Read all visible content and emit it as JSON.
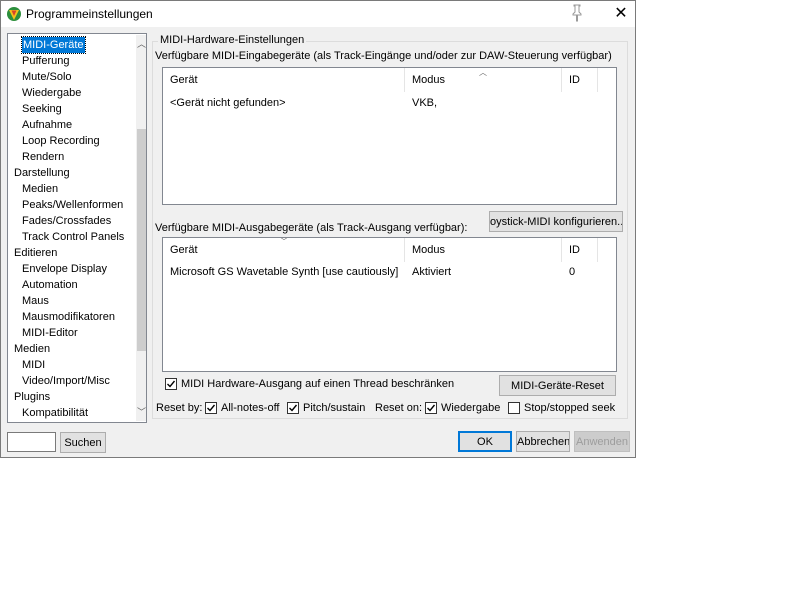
{
  "window": {
    "title": "Programmeinstellungen"
  },
  "tree": {
    "items": [
      {
        "label": "MIDI-Geräte",
        "level": 1,
        "selected": true
      },
      {
        "label": "Pufferung",
        "level": 1
      },
      {
        "label": "Mute/Solo",
        "level": 1
      },
      {
        "label": "Wiedergabe",
        "level": 1
      },
      {
        "label": "Seeking",
        "level": 1
      },
      {
        "label": "Aufnahme",
        "level": 1
      },
      {
        "label": "Loop Recording",
        "level": 1
      },
      {
        "label": "Rendern",
        "level": 1
      },
      {
        "label": "Darstellung",
        "level": 0
      },
      {
        "label": "Medien",
        "level": 1
      },
      {
        "label": "Peaks/Wellenformen",
        "level": 1
      },
      {
        "label": "Fades/Crossfades",
        "level": 1
      },
      {
        "label": "Track Control Panels",
        "level": 1
      },
      {
        "label": "Editieren",
        "level": 0
      },
      {
        "label": "Envelope Display",
        "level": 1
      },
      {
        "label": "Automation",
        "level": 1
      },
      {
        "label": "Maus",
        "level": 1
      },
      {
        "label": "Mausmodifikatoren",
        "level": 1
      },
      {
        "label": "MIDI-Editor",
        "level": 1
      },
      {
        "label": "Medien",
        "level": 0
      },
      {
        "label": "MIDI",
        "level": 1
      },
      {
        "label": "Video/Import/Misc",
        "level": 1
      },
      {
        "label": "Plugins",
        "level": 0
      },
      {
        "label": "Kompatibilität",
        "level": 1
      }
    ]
  },
  "group": {
    "title": "MIDI-Hardware-Einstellungen"
  },
  "inputs": {
    "label": "Verfügbare MIDI-Eingabegeräte (als Track-Eingänge und/oder zur DAW-Steuerung verfügbar)",
    "columns": [
      "Gerät",
      "Modus",
      "ID"
    ],
    "rows": [
      [
        "<Gerät nicht gefunden>",
        "VKB,",
        ""
      ]
    ]
  },
  "outputs": {
    "label": "Verfügbare MIDI-Ausgabegeräte (als Track-Ausgang verfügbar):",
    "joystick_button": "oystick-MIDI konfigurieren...",
    "columns": [
      "Gerät",
      "Modus",
      "ID"
    ],
    "rows": [
      [
        "Microsoft GS Wavetable Synth [use cautiously]",
        "Aktiviert",
        "0"
      ]
    ]
  },
  "options": {
    "thread_limit": {
      "label": "MIDI Hardware-Ausgang auf einen Thread beschränken",
      "checked": true
    },
    "reset_button": "MIDI-Geräte-Reset",
    "reset_by_label": "Reset by:",
    "all_notes_off": {
      "label": "All-notes-off",
      "checked": true
    },
    "pitch_sustain": {
      "label": "Pitch/sustain",
      "checked": true
    },
    "reset_on_label": "Reset on:",
    "wiedergabe": {
      "label": "Wiedergabe",
      "checked": true
    },
    "stop_seek": {
      "label": "Stop/stopped seek",
      "checked": false
    }
  },
  "footer": {
    "search_value": "",
    "search_button": "Suchen",
    "ok": "OK",
    "cancel": "Abbrechen",
    "apply": "Anwenden"
  },
  "colors": {
    "selection": "#0078d7",
    "dialog_bg": "#f0f0f0"
  }
}
